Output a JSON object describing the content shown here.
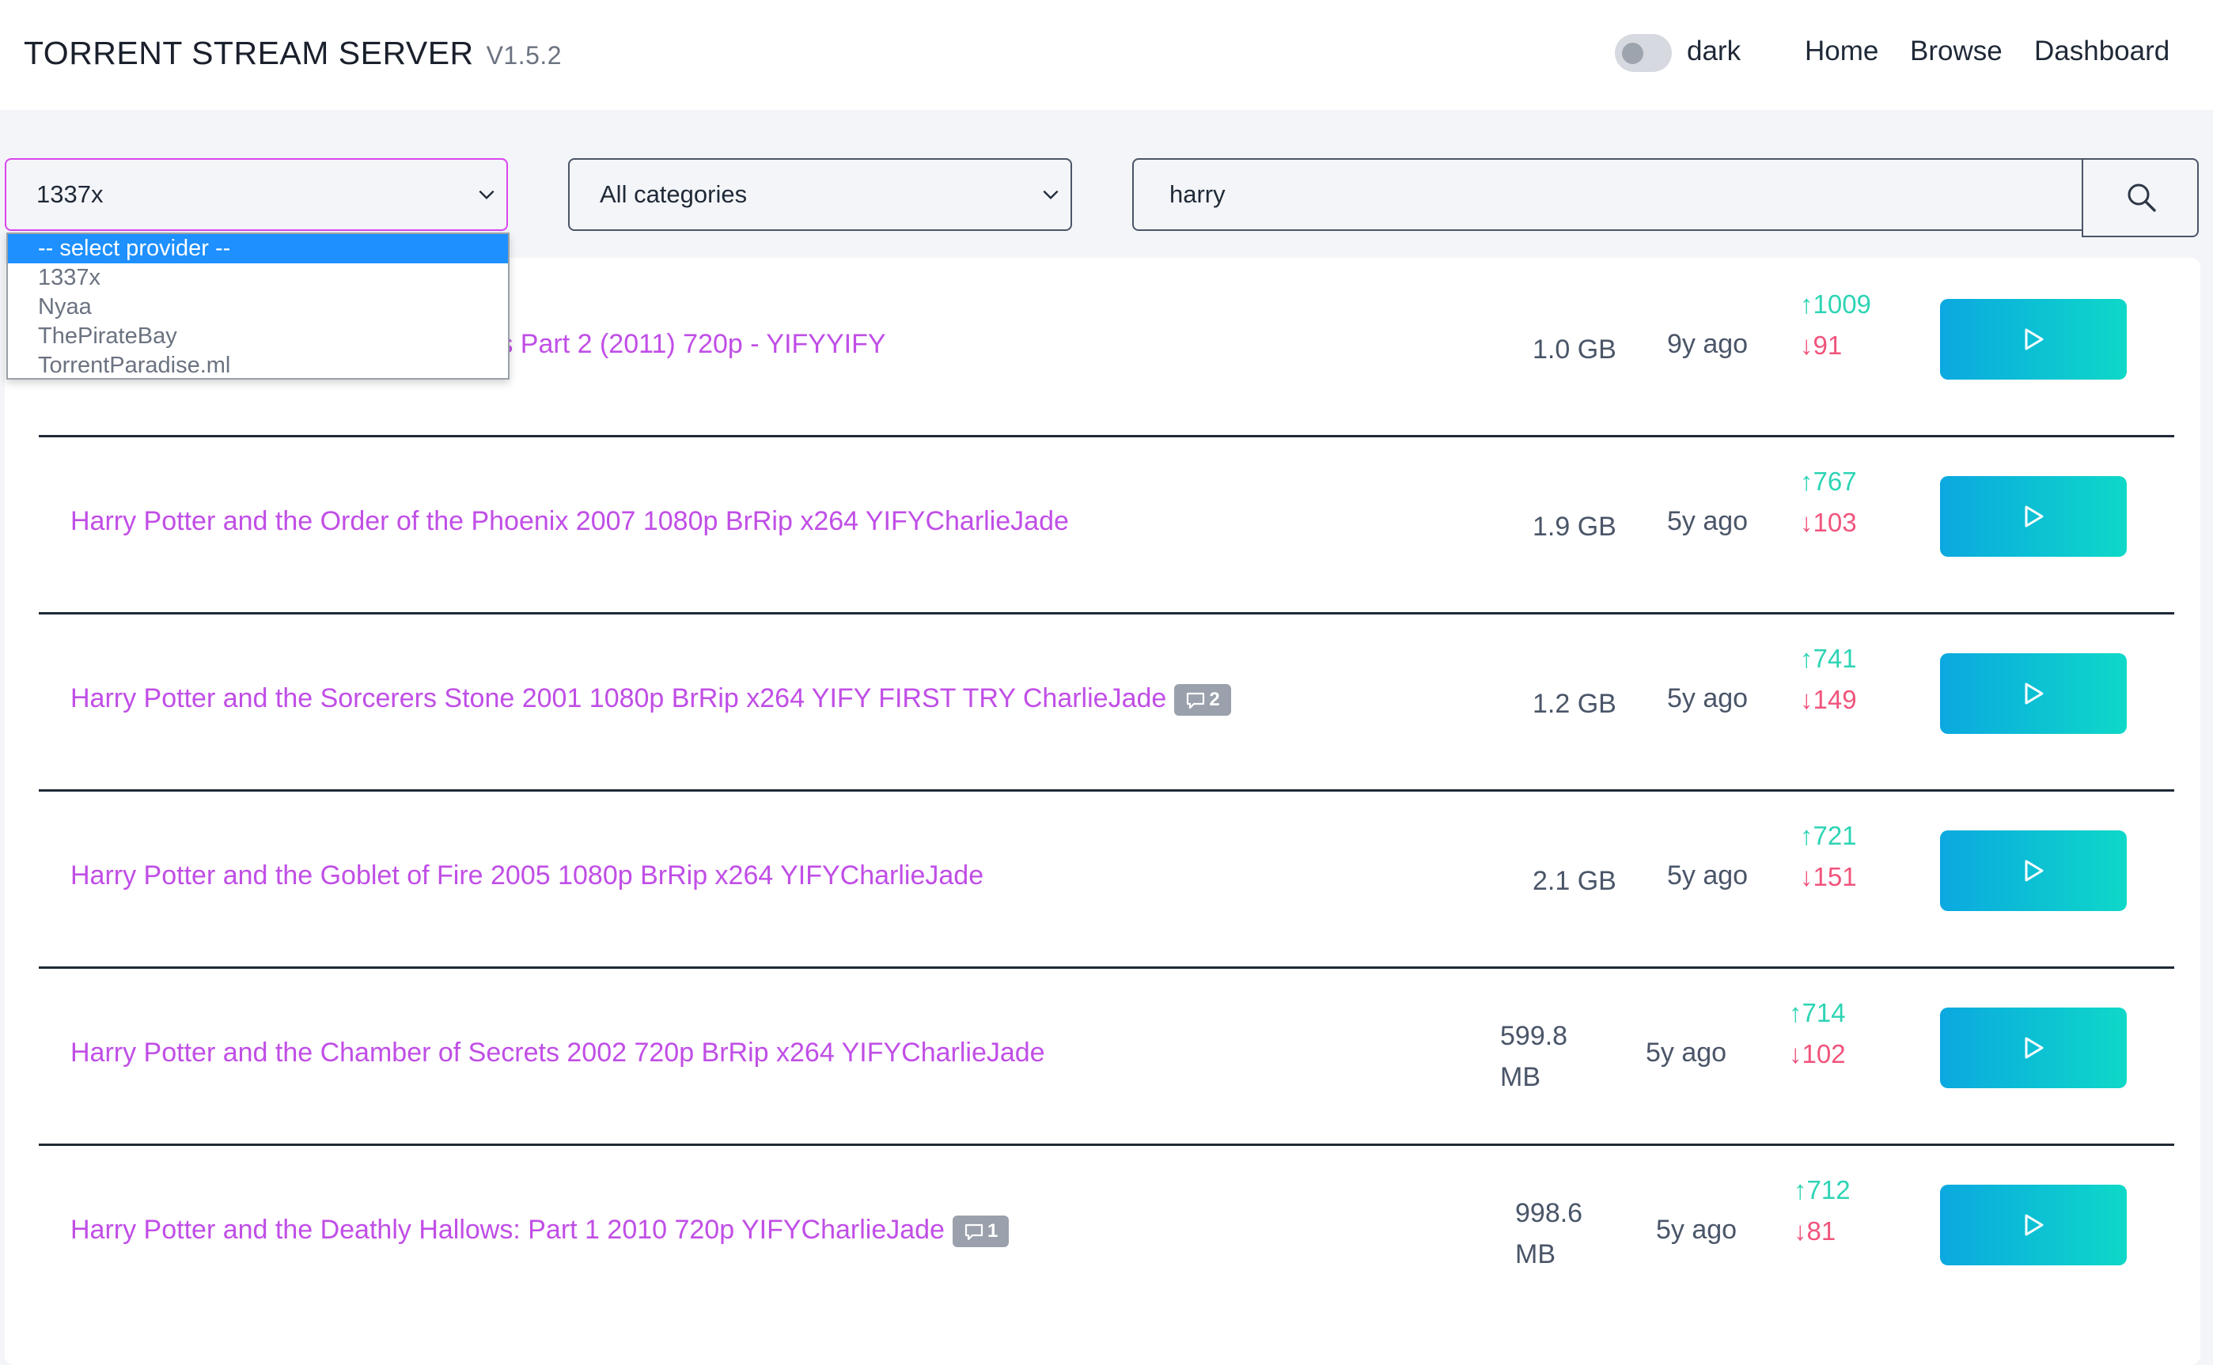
{
  "header": {
    "brand": "TORRENT STREAM SERVER",
    "version": "V1.5.2",
    "theme_toggle_label": "dark",
    "nav": [
      "Home",
      "Browse",
      "Dashboard"
    ]
  },
  "filters": {
    "provider_value": "1337x",
    "category_value": "All categories",
    "search_value": "harry"
  },
  "provider_dropdown": {
    "options": [
      "-- select provider --",
      "1337x",
      "Nyaa",
      "ThePirateBay",
      "TorrentParadise.ml"
    ],
    "highlighted": "-- select provider --"
  },
  "results": [
    {
      "title": "Harry Potter and the Deathly Hallows Part 2 (2011) 720p - YIFYYIFY",
      "size": "1.0 GB",
      "age": "9y ago",
      "seeders": "↑1009",
      "leechers": "↓91",
      "comments": null
    },
    {
      "title": "Harry Potter and the Order of the Phoenix 2007 1080p BrRip x264 YIFYCharlieJade",
      "size": "1.9 GB",
      "age": "5y ago",
      "seeders": "↑767",
      "leechers": "↓103",
      "comments": null
    },
    {
      "title": "Harry Potter and the Sorcerers Stone 2001 1080p BrRip x264 YIFY FIRST TRY CharlieJade",
      "size": "1.2 GB",
      "age": "5y ago",
      "seeders": "↑741",
      "leechers": "↓149",
      "comments": "2"
    },
    {
      "title": "Harry Potter and the Goblet of Fire 2005 1080p BrRip x264 YIFYCharlieJade",
      "size": "2.1 GB",
      "age": "5y ago",
      "seeders": "↑721",
      "leechers": "↓151",
      "comments": null
    },
    {
      "title": "Harry Potter and the Chamber of Secrets 2002 720p BrRip x264 YIFYCharlieJade",
      "size": "599.8 MB",
      "age": "5y ago",
      "seeders": "↑714",
      "leechers": "↓102",
      "comments": null
    },
    {
      "title": "Harry Potter and the Deathly Hallows: Part 1 2010 720p YIFYCharlieJade",
      "size": "998.6 MB",
      "age": "5y ago",
      "seeders": "↑712",
      "leechers": "↓81",
      "comments": "1"
    }
  ],
  "colors": {
    "accent_title": "#c04ee6",
    "seeders": "#2dd4b4",
    "leechers": "#f0547c",
    "play_gradient_start": "#0ba8e0",
    "play_gradient_end": "#0ed8c8"
  }
}
